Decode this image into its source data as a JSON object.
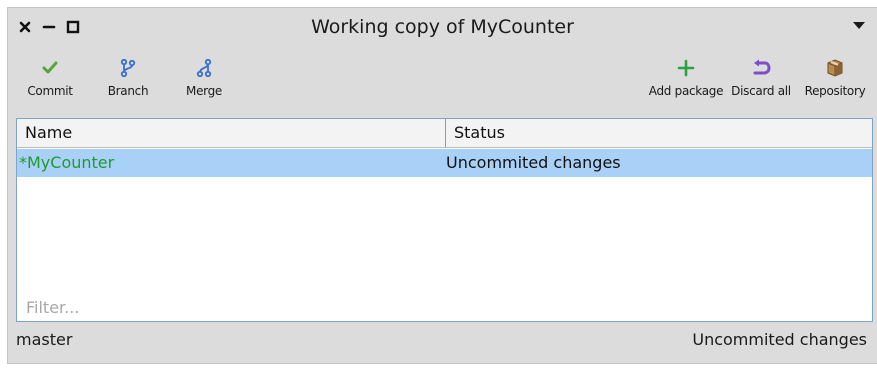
{
  "window": {
    "title": "Working copy of MyCounter"
  },
  "toolbar": {
    "commit_label": "Commit",
    "branch_label": "Branch",
    "merge_label": "Merge",
    "add_package_label": "Add package",
    "discard_all_label": "Discard all",
    "repository_label": "Repository"
  },
  "table": {
    "columns": [
      "Name",
      "Status"
    ],
    "rows": [
      {
        "name": "*MyCounter",
        "status": "Uncommited changes",
        "selected": true
      }
    ]
  },
  "filter": {
    "placeholder": "Filter..."
  },
  "statusbar": {
    "branch": "master",
    "status": "Uncommited changes"
  },
  "icons": {
    "close": "close-icon",
    "minimize": "minimize-icon",
    "maximize": "maximize-icon",
    "menu": "dropdown-arrow-icon",
    "commit": "checkmark-icon",
    "branch": "branch-icon",
    "merge": "merge-icon",
    "add_package": "plus-icon",
    "discard_all": "undo-icon",
    "repository": "package-box-icon"
  },
  "colors": {
    "window_bg": "#dcdcdc",
    "selection_bg": "#a9d1f7",
    "modified_name": "#1f9a2f",
    "commit_green": "#5aa33c",
    "git_blue": "#3a6fd0",
    "add_green": "#2ea043",
    "discard_purple": "#7a4fc9"
  }
}
